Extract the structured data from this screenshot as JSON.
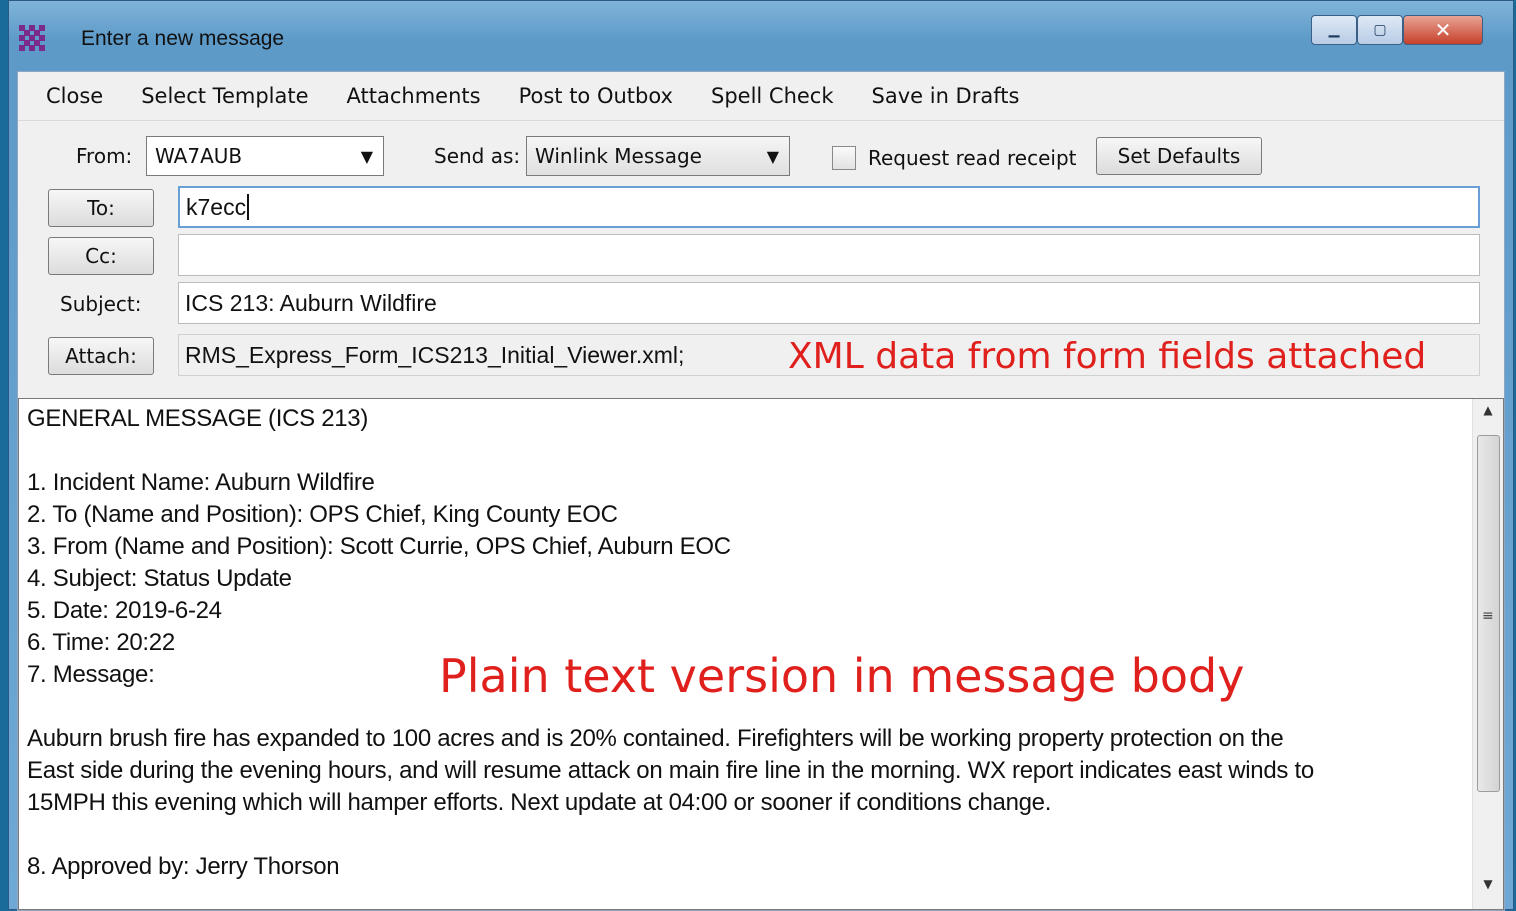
{
  "window": {
    "title": "Enter a new message",
    "minimize_glyph": "▁",
    "maximize_glyph": "▢",
    "close_glyph": "✕"
  },
  "menu": [
    "Close",
    "Select Template",
    "Attachments",
    "Post to Outbox",
    "Spell Check",
    "Save in Drafts"
  ],
  "header": {
    "from_label": "From:",
    "from_value": "WA7AUB",
    "send_as_label": "Send as:",
    "send_as_value": "Winlink Message",
    "read_receipt_label": "Request read receipt",
    "read_receipt_checked": false,
    "set_defaults_label": "Set Defaults",
    "to_button": "To:",
    "to_value": "k7ecc",
    "cc_button": "Cc:",
    "cc_value": "",
    "subject_label": "Subject:",
    "subject_value": "ICS 213: Auburn Wildfire",
    "attach_button": "Attach:",
    "attach_value": "RMS_Express_Form_ICS213_Initial_Viewer.xml;"
  },
  "annotations": {
    "xml_note": "XML data from form fields attached",
    "body_note": "Plain text version in message body"
  },
  "body_lines": [
    "GENERAL MESSAGE (ICS 213)",
    "",
    "1. Incident Name: Auburn Wildfire",
    "2. To (Name and Position): OPS Chief, King County EOC",
    "3. From (Name and Position): Scott Currie, OPS Chief, Auburn EOC",
    "4. Subject: Status Update",
    "5. Date: 2019-6-24",
    "6. Time: 20:22",
    "7. Message:",
    "",
    "Auburn brush fire has expanded to 100 acres and is 20% contained. Firefighters will be working property protection on the",
    "East side during the evening hours, and will resume attack on main fire line in the morning. WX report indicates east winds to",
    "15MPH this evening which will hamper efforts. Next update at 04:00 or sooner if conditions change.",
    "",
    "8. Approved by: Jerry Thorson"
  ],
  "scrollbar": {
    "up_glyph": "▲",
    "down_glyph": "▼",
    "grip_glyph": "≡"
  },
  "colors": {
    "annotation": "#e0201c",
    "title_bar": "#5d9ac8"
  }
}
